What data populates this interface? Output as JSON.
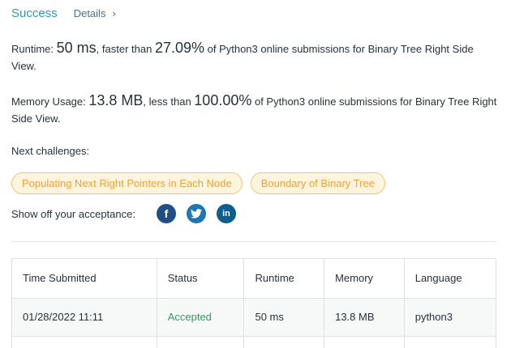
{
  "header": {
    "status": "Success",
    "details_label": "Details",
    "details_chevron": "›"
  },
  "runtime": {
    "label": "Runtime: ",
    "value": "50 ms",
    "mid": ", faster than ",
    "percent": "27.09%",
    "tail": " of Python3 online submissions for Binary Tree Right Side View."
  },
  "memory": {
    "label": "Memory Usage: ",
    "value": "13.8 MB",
    "mid": ", less than ",
    "percent": "100.00%",
    "tail": " of Python3 online submissions for Binary Tree Right Side View."
  },
  "next": {
    "label": "Next challenges:",
    "chips": [
      "Populating Next Right Pointers in Each Node",
      "Boundary of Binary Tree"
    ]
  },
  "share": {
    "label": "Show off your acceptance:",
    "icons": [
      {
        "name": "facebook-icon",
        "glyph": "f",
        "color": "#1f4f86"
      },
      {
        "name": "twitter-icon",
        "glyph": "t",
        "color": "#1e77b4"
      },
      {
        "name": "linkedin-icon",
        "glyph": "in",
        "color": "#0b5e8d"
      }
    ]
  },
  "table": {
    "headers": [
      "Time Submitted",
      "Status",
      "Runtime",
      "Memory",
      "Language"
    ],
    "rows": [
      [
        "01/28/2022 11:11",
        "Accepted",
        "50 ms",
        "13.8 MB",
        "python3"
      ]
    ]
  },
  "colors": {
    "success": "#2e9aa8",
    "accepted": "#2d9d62",
    "chip_text": "#e8a33a",
    "chip_bg": "#fff4dd"
  }
}
